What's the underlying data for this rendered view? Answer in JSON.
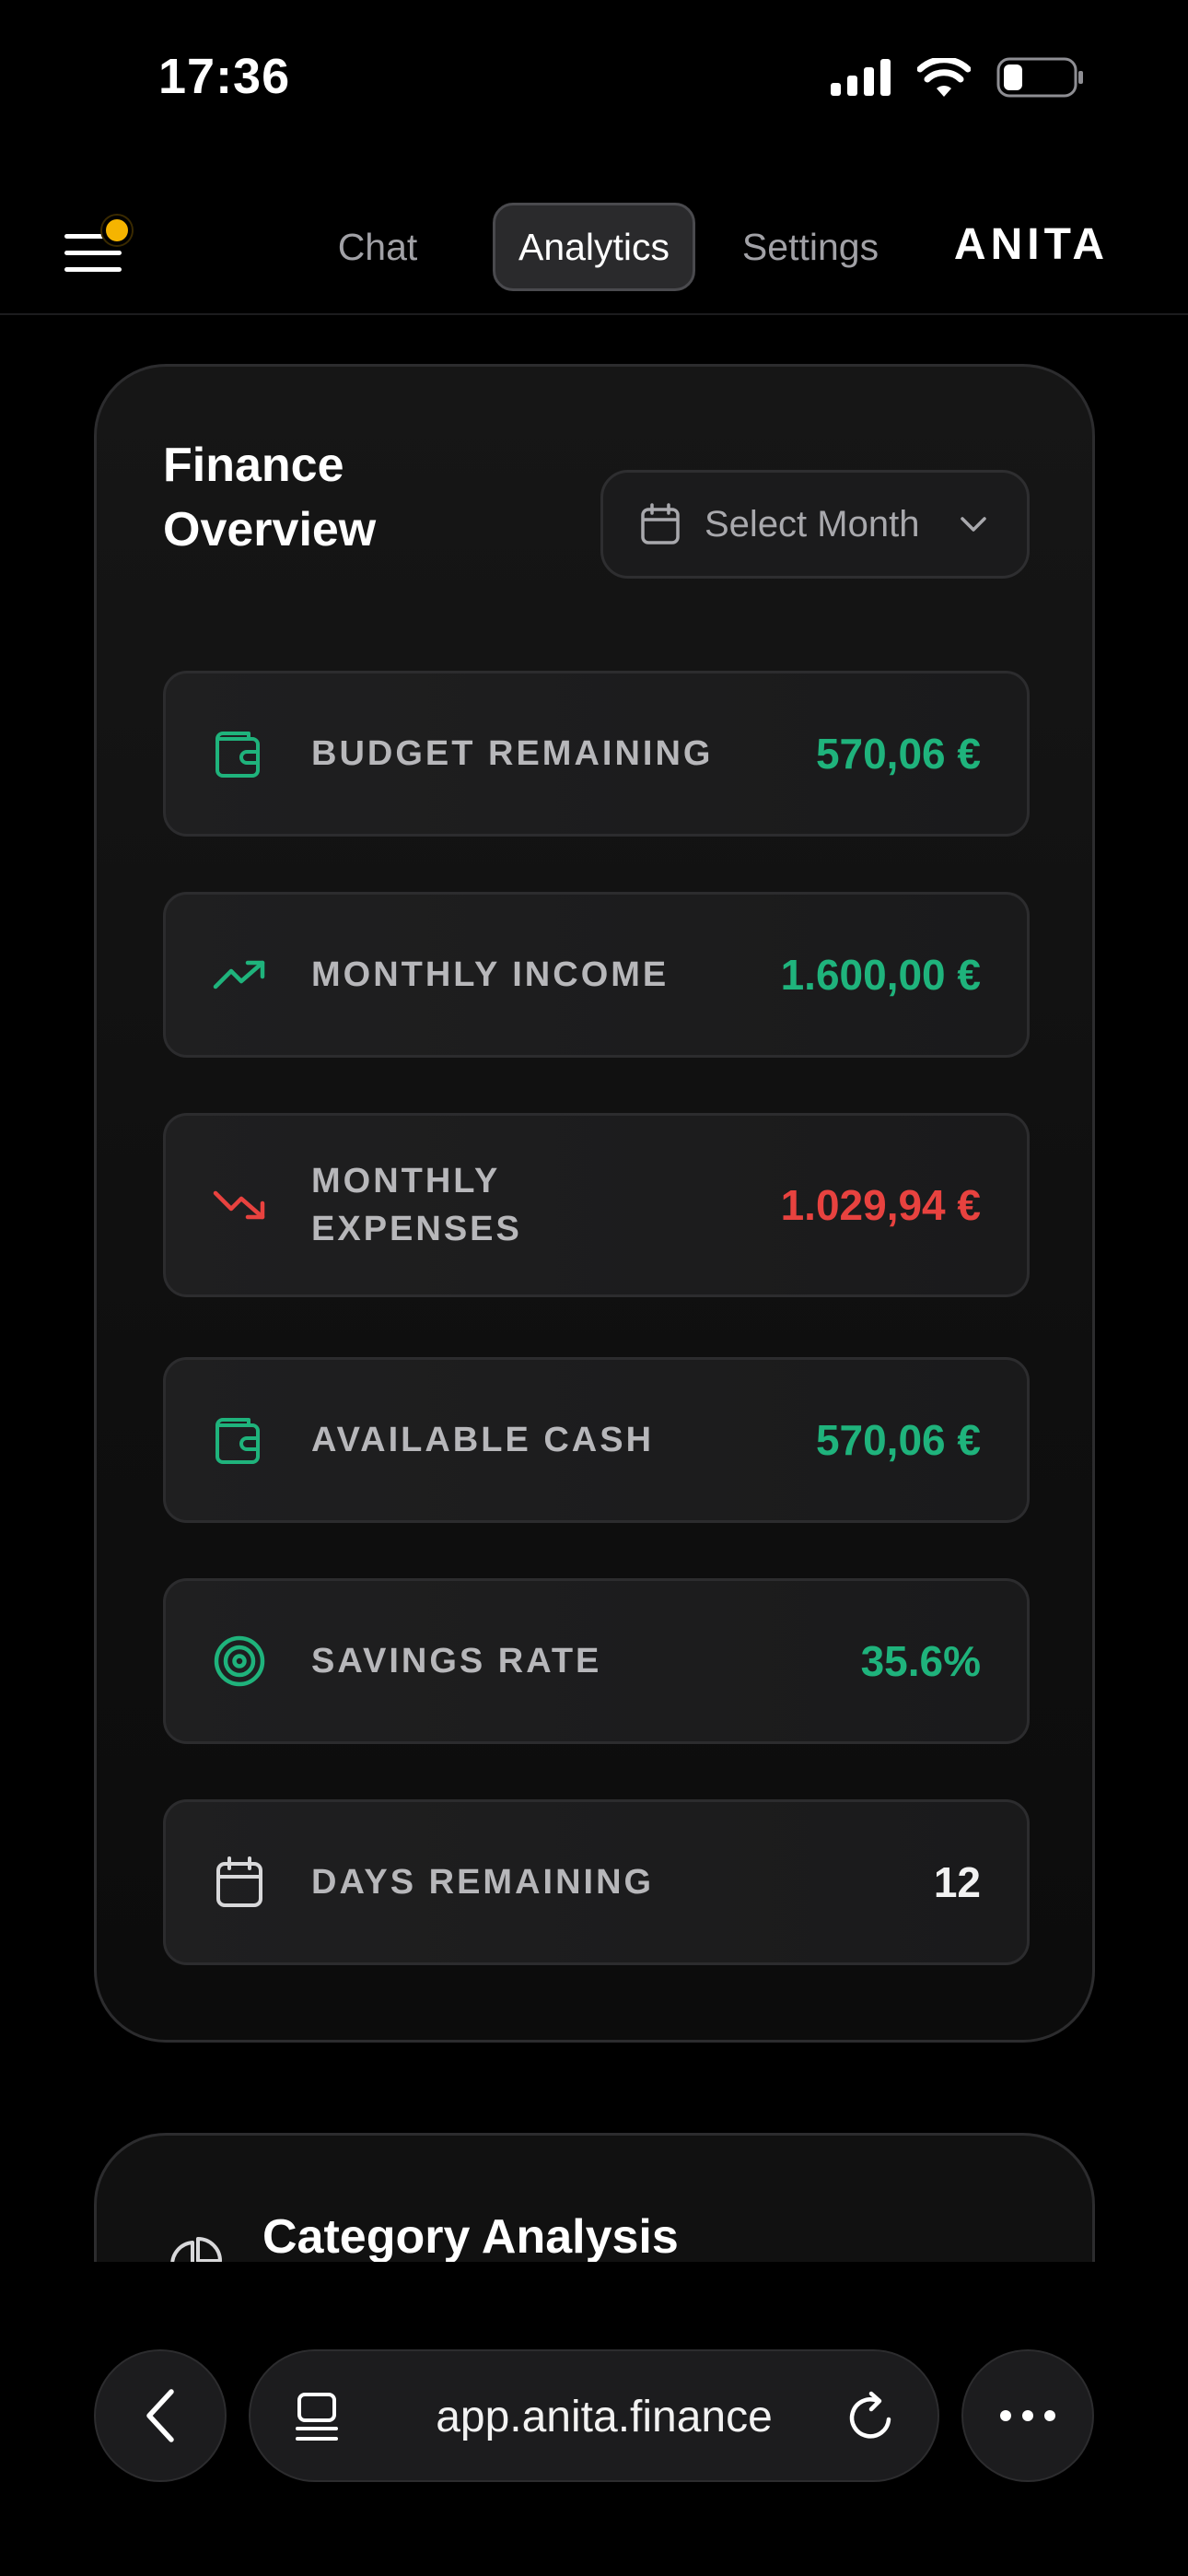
{
  "status_bar": {
    "time": "17:36"
  },
  "header": {
    "tabs": [
      {
        "label": "Chat"
      },
      {
        "label": "Analytics"
      },
      {
        "label": "Settings"
      }
    ],
    "active_tab": "Analytics",
    "brand": "ANITA"
  },
  "finance": {
    "title": "Finance Overview",
    "month_select": {
      "label": "Select Month"
    },
    "metrics": [
      {
        "label": "BUDGET REMAINING",
        "value": "570,06 €",
        "icon": "wallet-icon",
        "color": "#1fb37c"
      },
      {
        "label": "MONTHLY INCOME",
        "value": "1.600,00 €",
        "icon": "trending-up-icon",
        "color": "#1fb37c"
      },
      {
        "label": "MONTHLY EXPENSES",
        "value": "1.029,94 €",
        "icon": "trending-down-icon",
        "color": "#e8423f"
      },
      {
        "label": "AVAILABLE CASH",
        "value": "570,06 €",
        "icon": "wallet-icon",
        "color": "#1fb37c"
      },
      {
        "label": "SAVINGS RATE",
        "value": "35.6%",
        "icon": "target-icon",
        "color": "#1fb37c"
      },
      {
        "label": "DAYS REMAINING",
        "value": "12",
        "icon": "calendar-icon",
        "color": "#f2f2f2"
      }
    ]
  },
  "category": {
    "title": "Category Analysis",
    "icon": "pie-chart-icon"
  },
  "browser": {
    "url": "app.anita.finance"
  },
  "colors": {
    "accent_green": "#1fb37c",
    "accent_red": "#e8423f",
    "notification_dot": "#f5b400"
  }
}
